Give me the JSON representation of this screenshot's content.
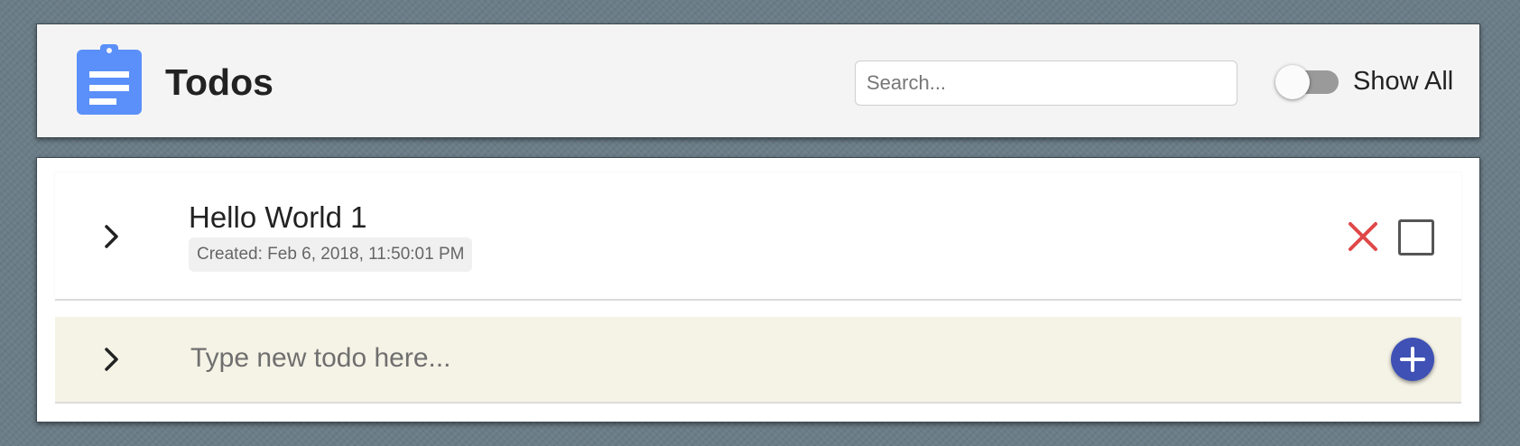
{
  "header": {
    "logo_icon": "clipboard-icon",
    "title": "Todos",
    "search": {
      "placeholder": "Search...",
      "value": ""
    },
    "toggle": {
      "label": "Show All",
      "checked": false
    }
  },
  "todos": [
    {
      "title": "Hello World 1",
      "created": "Created: Feb 6, 2018, 11:50:01 PM",
      "completed": false,
      "expand_icon": "chevron-right-icon",
      "delete_icon": "close-icon"
    }
  ],
  "new_todo": {
    "placeholder": "Type new todo here...",
    "value": "",
    "expand_icon": "chevron-right-icon",
    "add_icon": "plus-icon"
  },
  "colors": {
    "background": "#6b7d88",
    "header_bg": "#f4f4f4",
    "logo": "#5b8ff9",
    "delete": "#e04848",
    "add_button": "#3f51b5",
    "new_row_bg": "#f5f3e6"
  }
}
